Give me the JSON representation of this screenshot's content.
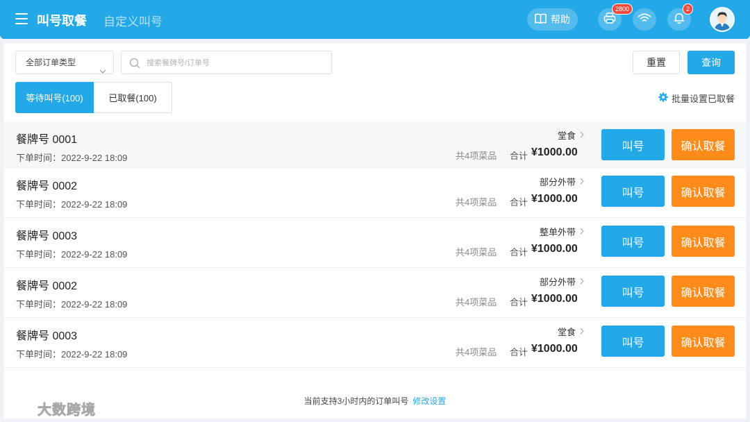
{
  "header": {
    "title": "叫号取餐",
    "tab2": "自定义叫号",
    "help_label": "帮助",
    "printer_badge": "2800",
    "bell_badge": "2"
  },
  "filters": {
    "order_type": "全部订单类型",
    "search_placeholder": "搜索餐牌号/订单号",
    "reset_label": "重置",
    "query_label": "查询"
  },
  "tabs": [
    {
      "label": "等待叫号(100)"
    },
    {
      "label": "已取餐(100)"
    }
  ],
  "batch_label": "批量设置已取餐",
  "orders": [
    {
      "title": "餐牌号 0001",
      "time": "下单时间：2022-9-22 18:09",
      "type": "堂食",
      "items": "共4项菜品",
      "total_label": "合计",
      "total": "¥1000.00",
      "call_label": "叫号",
      "confirm_label": "确认取餐"
    },
    {
      "title": "餐牌号 0002",
      "time": "下单时间：2022-9-22 18:09",
      "type": "部分外带",
      "items": "共4项菜品",
      "total_label": "合计",
      "total": "¥1000.00",
      "call_label": "叫号",
      "confirm_label": "确认取餐"
    },
    {
      "title": "餐牌号 0003",
      "time": "下单时间：2022-9-22 18:09",
      "type": "整单外带",
      "items": "共4项菜品",
      "total_label": "合计",
      "total": "¥1000.00",
      "call_label": "叫号",
      "confirm_label": "确认取餐"
    },
    {
      "title": "餐牌号 0002",
      "time": "下单时间：2022-9-22 18:09",
      "type": "部分外带",
      "items": "共4项菜品",
      "total_label": "合计",
      "total": "¥1000.00",
      "call_label": "叫号",
      "confirm_label": "确认取餐"
    },
    {
      "title": "餐牌号 0003",
      "time": "下单时间：2022-9-22 18:09",
      "type": "堂食",
      "items": "共4项菜品",
      "total_label": "合计",
      "total": "¥1000.00",
      "call_label": "叫号",
      "confirm_label": "确认取餐"
    }
  ],
  "footer": {
    "text": "当前支持3小时内的订单叫号",
    "link": "修改设置"
  },
  "watermark": "大数跨境",
  "colors": {
    "primary": "#23a9e8",
    "accent": "#ff8c1a",
    "badge": "#f04a3e"
  }
}
